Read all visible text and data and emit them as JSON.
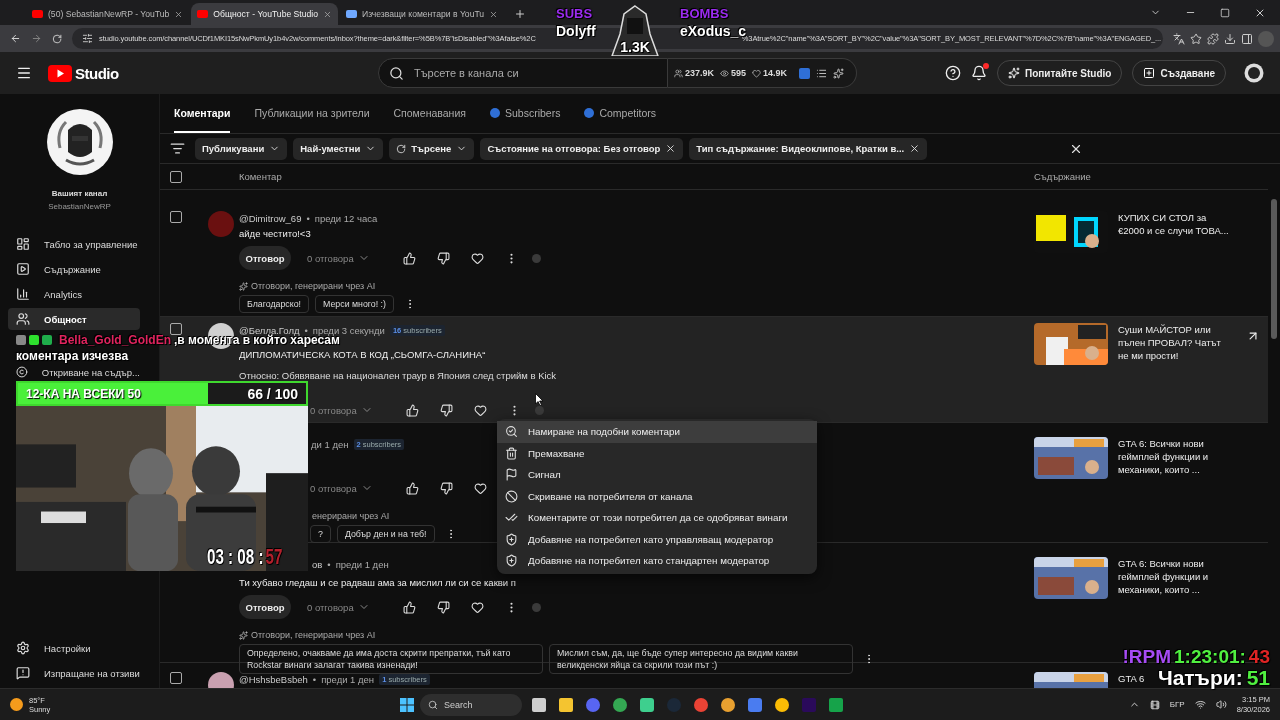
{
  "browser": {
    "tabs": [
      {
        "title": "(50) SebastianNewRP - YouTub",
        "selected": false
      },
      {
        "title": "Общност - YouTube Studio",
        "selected": true
      },
      {
        "title": "Изчезващи коментари в YouTu",
        "selected": false
      }
    ],
    "url_start": "studio.youtube.com/channel/UCDf1MKI15sNwPkmUy1b4v2w/comments/inbox?theme=dark&filter=%5B%7B\"isDisabled\"%3Afalse%2C",
    "url_end": "%3Atrue%2C\"name\"%3A\"SORT_BY\"%2C\"value\"%3A\"SORT_BY_MOST_RELEVANT\"%7D%2C%7B\"name\"%3A\"ENGAGED_..."
  },
  "stream_overlay": {
    "subs_label": "SUBS",
    "subs_name": "Dolyff",
    "bombs_label": "BOMBS",
    "bombs_name": "eXodus_c",
    "mascot_count": "1.3K",
    "chat_user": "Bella_Gold_GoldEn",
    "chat_message": ",в момента в който харесам",
    "chat_message_2": "коментара изчезва",
    "goal": {
      "label": "12-КА НА ВСЕКИ 50",
      "count": "66 / 100",
      "level": 0.66
    },
    "timer": {
      "main": "03 : 08 :",
      "seconds": "57"
    },
    "rpm": {
      "label": "!RPM",
      "time": "1:23:01:",
      "tail": "43"
    },
    "chatters": {
      "label": "Чатъри:",
      "count": "51"
    }
  },
  "header": {
    "logo": "Studio",
    "search_placeholder": "Търсете в канала си",
    "stats": [
      "237.9K",
      "595",
      "14.9K"
    ],
    "notification": true,
    "ask_button": "Попитайте Studio",
    "create_button": "Създаване"
  },
  "sidebar": {
    "channel_label": "Вашият канал",
    "channel_name": "SebastianNewRP",
    "items": [
      {
        "label": "Табло за управление",
        "selected": false
      },
      {
        "label": "Съдържание",
        "selected": false
      },
      {
        "label": "Analytics",
        "selected": false
      },
      {
        "label": "Общност",
        "selected": true
      },
      {
        "label": "Откриване на съдър...",
        "selected": false
      }
    ],
    "bottom_items": [
      "Настройки",
      "Изпращане на отзиви"
    ]
  },
  "main_tabs": [
    {
      "label": "Коментари",
      "selected": true,
      "kind": "plain"
    },
    {
      "label": "Публикации на зрители",
      "selected": false,
      "kind": "plain"
    },
    {
      "label": "Споменавания",
      "selected": false,
      "kind": "plain"
    },
    {
      "label": "Subscribers",
      "selected": false,
      "kind": "extension"
    },
    {
      "label": "Competitors",
      "selected": false,
      "kind": "extension"
    }
  ],
  "filters": [
    {
      "label": "Публикувани",
      "kind": "dropdown"
    },
    {
      "label": "Най-уместни",
      "kind": "dropdown"
    },
    {
      "label": "Търсене",
      "kind": "search"
    },
    {
      "label": "Състояние на отговора: Без отговор",
      "kind": "removable"
    },
    {
      "label": "Тип съдържание: Видеоклипове, Кратки в...",
      "kind": "removable"
    }
  ],
  "table_header": {
    "select_all_checked": false,
    "comment": "Коментар",
    "content": "Съдържание"
  },
  "comments": [
    {
      "checked": false,
      "highlighted": false,
      "author": "@Dimitrow_69",
      "dot": "•",
      "time": "преди 12 часа",
      "text": "айде честито!<3",
      "reply": "Отговор",
      "replies": "0 отговора",
      "ai_label": "Отговори, генерирани чрез AI",
      "suggestions": [
        "Благодарско!",
        "Мерси много! :)"
      ],
      "content_title": "КУПИХ СИ СТОЛ за €2000 и се случи ТОВА..."
    },
    {
      "checked": false,
      "highlighted": true,
      "author": "@Белла.Голд",
      "dot": "•",
      "time": "преди 3 секунди",
      "subscriber_count": "16",
      "subscriber_label": "subscribers",
      "text": "ДИПЛОМАТИЧЕСКА КОТА В КОД „СЬОМГА-СЛАНИНА“",
      "regarding": "Относно: Обявяване на национален траур в Япония след стрийм в Kick",
      "replies": "0 отговора",
      "content_title": "Суши МАЙСТОР или пълен ПРОВАЛ? Чатът не ми прости!"
    },
    {
      "highlighted": false,
      "time": "ди 1 ден",
      "subscriber_count": "2",
      "subscriber_label": "subscribers",
      "replies": "0 отговора",
      "ai_label": "енерирани чрез AI",
      "suggestions": [
        "?",
        "Добър ден и на теб!"
      ],
      "content_title": "GTA 6: Всички нови геймплей функции и механики, които ..."
    },
    {
      "highlighted": false,
      "author": "ов",
      "dot": "•",
      "time": "преди 1 ден",
      "text": "Ти хубаво гледаш и се радваш ама за мислил ли си се какви п",
      "reply": "Отговор",
      "replies": "0 отговора",
      "ai_label": "Отговори, генерирани чрез AI",
      "suggestions": [
        "Определено, очакваме да има доста скрити препратки, тъй като Rockstar винаги залагат такива изненади!",
        "Мислил съм, да, ще бъде супер интересно да видим какви великденски яйца са скрили този път :)"
      ],
      "content_title": "GTA 6: Всички нови геймплей функции и механики, които ..."
    },
    {
      "checked": false,
      "highlighted": false,
      "author": "@HshsbeBsbeh",
      "dot": "•",
      "time": "преди 1 ден",
      "subscriber_count": "1",
      "subscriber_label": "subscribers",
      "content_title": "GTA 6"
    }
  ],
  "context_menu": [
    {
      "label": "Намиране на подобни коментари",
      "highlighted": true
    },
    {
      "label": "Премахване",
      "highlighted": false
    },
    {
      "label": "Сигнал",
      "highlighted": false
    },
    {
      "label": "Скриване на потребителя от канала",
      "highlighted": false
    },
    {
      "label": "Коментарите от този потребител да се одобряват винаги",
      "highlighted": false
    },
    {
      "label": "Добавяне на потребител като управляващ модератор",
      "highlighted": false
    },
    {
      "label": "Добавяне на потребител като стандартен модератор",
      "highlighted": false
    }
  ],
  "taskbar": {
    "temperature": "85°F",
    "weather": "Sunny",
    "search": "Search",
    "language": "БГР",
    "time": "3:15 PM",
    "date": "8/30/2026"
  }
}
